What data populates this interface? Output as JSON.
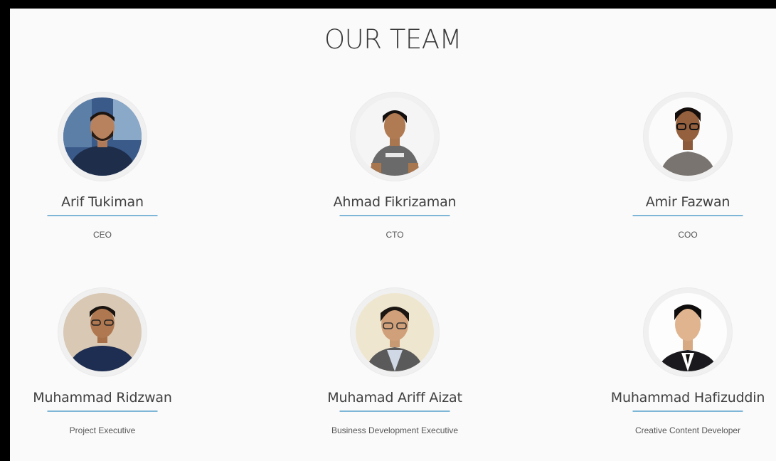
{
  "page": {
    "title": "OUR TEAM"
  },
  "team": [
    {
      "name": "Arif Tukiman",
      "role": "CEO"
    },
    {
      "name": "Ahmad Fikrizaman",
      "role": "CTO"
    },
    {
      "name": "Amir Fazwan",
      "role": "COO"
    },
    {
      "name": "Muhammad Ridzwan",
      "role": "Project Executive"
    },
    {
      "name": "Muhamad Ariff Aizat",
      "role": "Business Development Executive"
    },
    {
      "name": "Muhammad Hafizuddin",
      "role": "Creative Content Developer"
    }
  ]
}
